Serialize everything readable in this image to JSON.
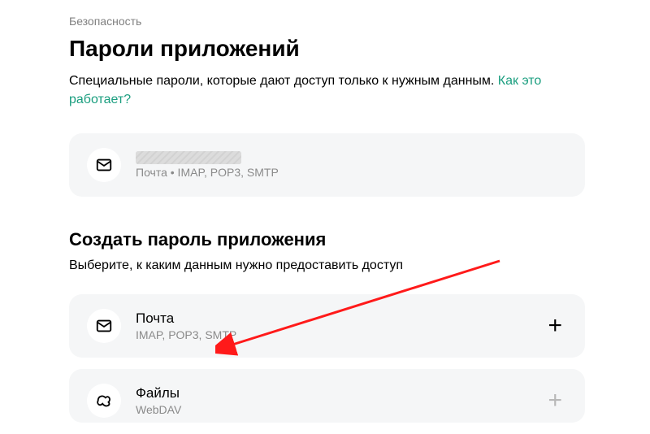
{
  "breadcrumb": "Безопасность",
  "page_title": "Пароли приложений",
  "description_text": "Специальные пароли, которые дают доступ только к нужным данным. ",
  "description_link": "Как это работает?",
  "existing": {
    "subtitle": "Почта • IMAP, POP3, SMTP"
  },
  "create_section": {
    "title": "Создать пароль приложения",
    "desc": "Выберите, к каким данным нужно предоставить доступ"
  },
  "options": {
    "mail": {
      "title": "Почта",
      "subtitle": "IMAP, POP3, SMTP"
    },
    "files": {
      "title": "Файлы",
      "subtitle": "WebDAV"
    }
  }
}
